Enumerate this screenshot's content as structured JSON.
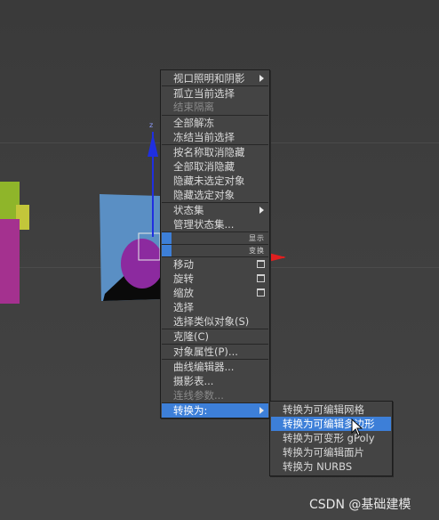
{
  "context_menu": {
    "items": [
      {
        "label": "视口照明和阴影",
        "submenu": true
      },
      {
        "label": "孤立当前选择"
      },
      {
        "label": "结束隔离",
        "disabled": true
      },
      {
        "label": "全部解冻"
      },
      {
        "label": "冻结当前选择"
      },
      {
        "label": "按名称取消隐藏"
      },
      {
        "label": "全部取消隐藏"
      },
      {
        "label": "隐藏未选定对象"
      },
      {
        "label": "隐藏选定对象"
      },
      {
        "label": "状态集",
        "submenu": true
      },
      {
        "label": "管理状态集..."
      },
      {
        "label": "移动"
      },
      {
        "label": "旋转"
      },
      {
        "label": "缩放"
      },
      {
        "label": "选择"
      },
      {
        "label": "选择类似对象(S)"
      },
      {
        "label": "克隆(C)"
      },
      {
        "label": "对象属性(P)..."
      },
      {
        "label": "曲线编辑器..."
      },
      {
        "label": "摄影表..."
      },
      {
        "label": "连线参数...",
        "disabled": true
      },
      {
        "label": "转换为:",
        "submenu": true,
        "highlighted": true
      }
    ],
    "quad_labels": {
      "display": "显示",
      "transform": "变换"
    }
  },
  "convert_submenu": {
    "items": [
      {
        "label": "转换为可编辑网格"
      },
      {
        "label": "转换为可编辑多边形",
        "highlighted": true
      },
      {
        "label": "转换为可变形 gPoly"
      },
      {
        "label": "转换为可编辑面片"
      },
      {
        "label": "转换为 NURBS"
      }
    ]
  },
  "watermark": "CSDN @基础建模",
  "colors": {
    "highlight": "#3d7fd8",
    "menu_bg": "#444444",
    "viewport_bg": "#3e3e3e",
    "gizmo_z": "#1f2fe0",
    "gizmo_x": "#e01f1f"
  }
}
